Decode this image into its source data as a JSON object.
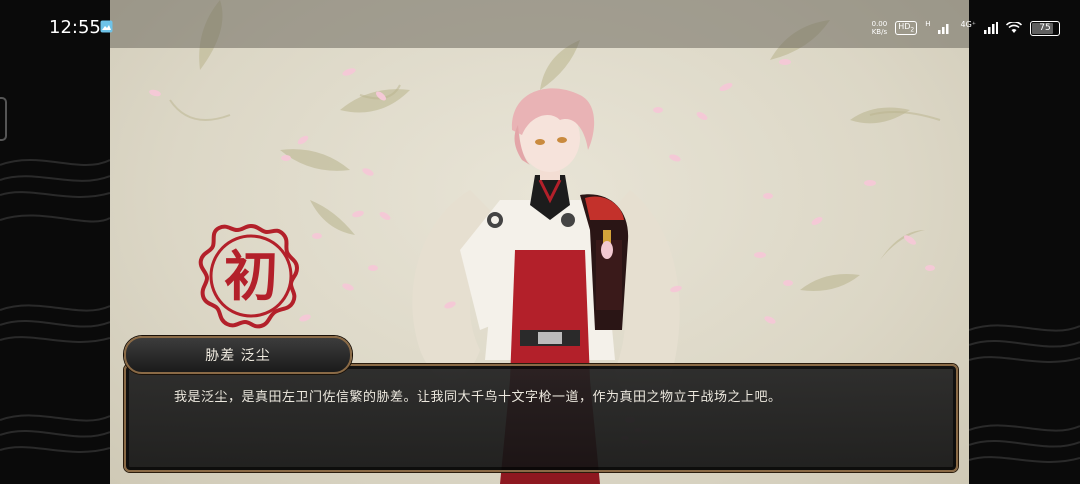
{
  "status_bar": {
    "time": "12:55",
    "net_speed_value": "0.00",
    "net_speed_unit": "KB/s",
    "hd_badge": "HD",
    "hd_sub": "2",
    "h_label": "H",
    "network_label": "4G⁺",
    "battery_level": "75"
  },
  "game": {
    "emblem_char": "初",
    "speaker_name": "胁差  泛尘",
    "dialogue_text": "我是泛尘，是真田左卫门佐信繁的胁差。让我同大千鸟十文字枪一道，作为真田之物立于战场之上吧。"
  },
  "colors": {
    "emblem_red": "#b3202a",
    "frame_gold": "#8a6a46",
    "dialogue_bg": "#222222",
    "petal_pink": "#f4c9d6"
  },
  "icons": [
    "gallery-icon",
    "signal-icon",
    "wifi-icon",
    "battery-icon"
  ]
}
